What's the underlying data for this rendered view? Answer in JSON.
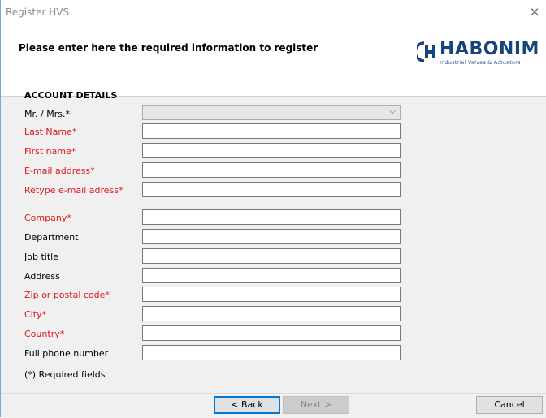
{
  "window": {
    "title": "Register HVS",
    "close_symbol": "✕"
  },
  "header": {
    "instruction": "Please enter here the required information to register",
    "logo": {
      "brand": "HABONIM",
      "tagline": "Industrial Valves & Actuators",
      "icon": "habonim-logo-icon",
      "brand_color": "#17447a"
    }
  },
  "form": {
    "section_title": "ACCOUNT DETAILS",
    "title_select": {
      "label": "Mr. / Mrs.*",
      "value": "",
      "chevron": "⌵"
    },
    "fields": [
      {
        "label": "Last Name*",
        "value": "",
        "required": true
      },
      {
        "label": "First name*",
        "value": "",
        "required": true
      },
      {
        "label": "E-mail address*",
        "value": "",
        "required": true
      },
      {
        "label": "Retype e-mail adress*",
        "value": "",
        "required": true
      },
      {
        "label": "Company*",
        "value": "",
        "required": true
      },
      {
        "label": "Department",
        "value": "",
        "required": false
      },
      {
        "label": "Job title",
        "value": "",
        "required": false
      },
      {
        "label": "Address",
        "value": "",
        "required": false
      },
      {
        "label": "Zip or postal code*",
        "value": "",
        "required": true
      },
      {
        "label": "City*",
        "value": "",
        "required": true
      },
      {
        "label": "Country*",
        "value": "",
        "required": true
      },
      {
        "label": "Full phone number",
        "value": "",
        "required": false
      }
    ],
    "required_note": "(*) Required fields",
    "required_color": "#e2161b"
  },
  "buttons": {
    "back": "< Back",
    "next": "Next >",
    "cancel": "Cancel"
  }
}
